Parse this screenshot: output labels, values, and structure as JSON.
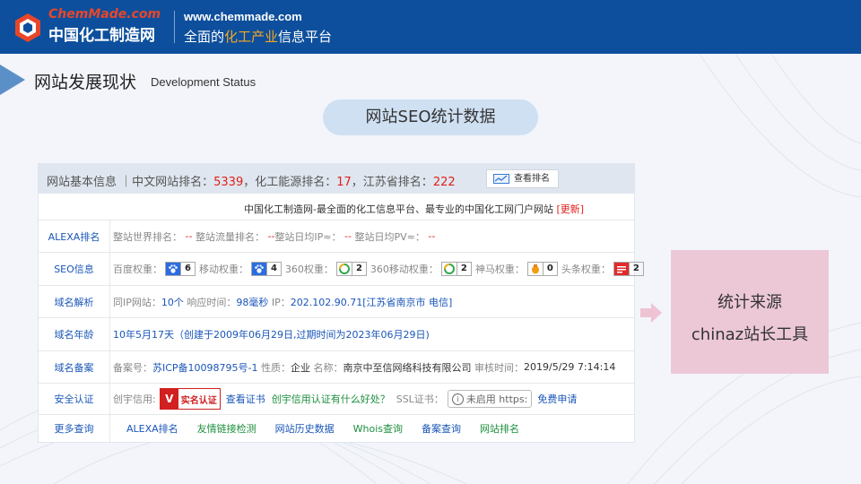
{
  "header": {
    "logo_top": "ChemMade.com",
    "logo_main": "中国化工制造网",
    "url": "www.chemmade.com",
    "slogan_pre": "全面的",
    "slogan_hl": "化工产业",
    "slogan_post": "信息平台"
  },
  "section": {
    "title": "网站发展现状",
    "subtitle": "Development Status"
  },
  "pill": "网站SEO统计数据",
  "panel": {
    "head_label": "网站基本信息 ｜中文网站排名：",
    "rank_cn": "5339",
    "sep1": "，化工能源排名：",
    "rank_chem": "17",
    "sep2": "，江苏省排名：",
    "rank_js": "222",
    "rank_button": "查看排名",
    "site_title": "中国化工制造网-最全面的化工信息平台、最专业的中国化工网门户网站",
    "update_link": "[更新]"
  },
  "rows": {
    "alexa": {
      "label": "ALEXA排名",
      "world": "整站世界排名：",
      "world_v": "--",
      "traffic": "整站流量排名：",
      "traffic_v": "--",
      "ip": "整站日均IP≈：",
      "ip_v": "--",
      "pv": "整站日均PV≈：",
      "pv_v": "--"
    },
    "seo": {
      "label": "SEO信息",
      "baidu": "百度权重：",
      "baidu_v": "6",
      "mobile": "移动权重：",
      "mobile_v": "4",
      "s360": "360权重：",
      "s360_v": "2",
      "s360m": "360移动权重：",
      "s360m_v": "2",
      "shenma": "神马权重：",
      "shenma_v": "0",
      "toutiao": "头条权重：",
      "toutiao_v": "2"
    },
    "domain": {
      "label": "域名解析",
      "sameip": "同IP网站：",
      "sameip_v": "10个",
      "resp": "响应时间：",
      "resp_v": "98毫秒",
      "ip": "IP：",
      "ip_v": "202.102.90.71[江苏省南京市 电信]"
    },
    "age": {
      "label": "域名年龄",
      "value": "10年5月17天（创建于2009年06月29日,过期时间为2023年06月29日)"
    },
    "icp": {
      "label": "域名备案",
      "no": "备案号：",
      "no_v": "苏ICP备10098795号-1",
      "nature": "性质：",
      "nature_v": "企业",
      "name": "名称：",
      "name_v": "南京中至信网络科技有限公司",
      "time": "审核时间：",
      "time_v": "2019/5/29 7:14:14"
    },
    "security": {
      "label": "安全认证",
      "credit": "创宇信用:",
      "cert_text": "实名认证",
      "view_cert": "查看证书",
      "benefit": "创宇信用认证有什么好处？",
      "ssl": "SSL证书：",
      "ssl_text": "未启用 https:",
      "free": "免费申请"
    },
    "more": {
      "label": "更多查询",
      "links": [
        "ALEXA排名",
        "友情链接检测",
        "网站历史数据",
        "Whois查询",
        "备案查询",
        "网站排名"
      ]
    }
  },
  "side": {
    "line1": "统计来源",
    "line2": "chinaz站长工具"
  },
  "colors": {
    "header": "#0d4f9c",
    "rank_red": "#e0201b",
    "link_blue": "#1a56b8",
    "link_green": "#1d8f3e",
    "side_box": "#ecc8d6"
  }
}
